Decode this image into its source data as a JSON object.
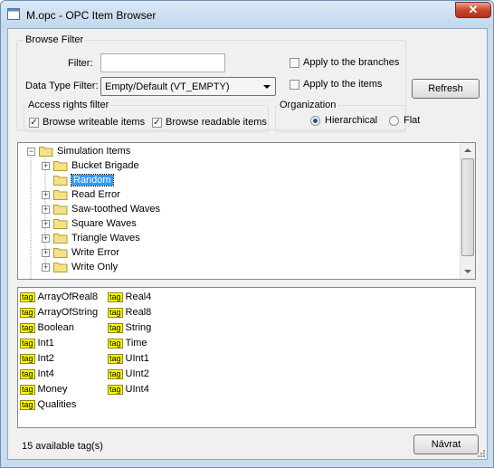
{
  "window": {
    "title": "M.opc - OPC Item Browser",
    "close_glyph": "✕"
  },
  "browse_filter": {
    "group_label": "Browse Filter",
    "filter_label": "Filter:",
    "filter_value": "",
    "data_type_label": "Data Type Filter:",
    "data_type_value": "Empty/Default (VT_EMPTY)",
    "apply_branches_label": "Apply to the branches",
    "apply_branches_checked": false,
    "apply_items_label": "Apply to the items",
    "apply_items_checked": false,
    "refresh_label": "Refresh"
  },
  "access_filter": {
    "group_label": "Access rights filter",
    "writeable_label": "Browse writeable  items",
    "writeable_checked": true,
    "readable_label": "Browse readable items",
    "readable_checked": true
  },
  "organization": {
    "group_label": "Organization",
    "hierarchical_label": "Hierarchical",
    "flat_label": "Flat",
    "selected": "Hierarchical"
  },
  "tree": {
    "root": "Simulation Items",
    "items": [
      {
        "label": "Bucket Brigade",
        "selected": false
      },
      {
        "label": "Random",
        "selected": true
      },
      {
        "label": "Read Error",
        "selected": false
      },
      {
        "label": "Saw-toothed Waves",
        "selected": false
      },
      {
        "label": "Square Waves",
        "selected": false
      },
      {
        "label": "Triangle Waves",
        "selected": false
      },
      {
        "label": "Write Error",
        "selected": false
      },
      {
        "label": "Write Only",
        "selected": false
      }
    ]
  },
  "tags": {
    "icon_text": "tag",
    "column1": [
      "ArrayOfReal8",
      "ArrayOfString",
      "Boolean",
      "Int1",
      "Int2",
      "Int4",
      "Money",
      "Qualities"
    ],
    "column2": [
      "Real4",
      "Real8",
      "String",
      "Time",
      "UInt1",
      "UInt2",
      "UInt4"
    ]
  },
  "status_text": "15 available tag(s)",
  "back_button_label": "Návrat"
}
